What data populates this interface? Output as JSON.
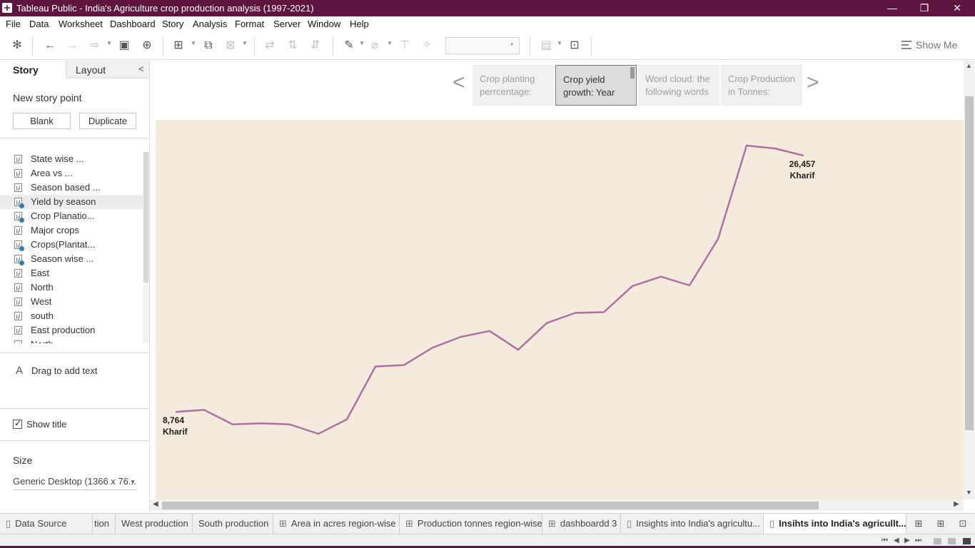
{
  "window": {
    "title": "Tableau Public - India's Agriculture crop production analysis (1997-2021)",
    "controls": {
      "minimize": "—",
      "restore": "❐",
      "close": "✕"
    }
  },
  "menu": [
    "File",
    "Data",
    "Worksheet",
    "Dashboard",
    "Story",
    "Analysis",
    "Format",
    "Server",
    "Window",
    "Help"
  ],
  "toolbar": {
    "show_me": "Show Me"
  },
  "left_panel": {
    "tabs": {
      "story": "Story",
      "layout": "Layout"
    },
    "new_story_point": "New story point",
    "blank_button": "Blank",
    "duplicate_button": "Duplicate",
    "sheets": [
      {
        "label": "State wise ...",
        "used": false,
        "highlighted": false
      },
      {
        "label": "Area vs ...",
        "used": false,
        "highlighted": false
      },
      {
        "label": "Season based ...",
        "used": false,
        "highlighted": false
      },
      {
        "label": "Yield by season",
        "used": true,
        "highlighted": true
      },
      {
        "label": "Crop Planatio...",
        "used": true,
        "highlighted": false
      },
      {
        "label": "Major crops",
        "used": false,
        "highlighted": false
      },
      {
        "label": "Crops(Plantat...",
        "used": true,
        "highlighted": false
      },
      {
        "label": "Season wise ...",
        "used": true,
        "highlighted": false
      },
      {
        "label": "East",
        "used": false,
        "highlighted": false
      },
      {
        "label": "North",
        "used": false,
        "highlighted": false
      },
      {
        "label": "West",
        "used": false,
        "highlighted": false
      },
      {
        "label": "south",
        "used": false,
        "highlighted": false
      },
      {
        "label": "East production",
        "used": false,
        "highlighted": false
      },
      {
        "label": "North...",
        "used": false,
        "highlighted": false
      }
    ],
    "drag_text": "Drag to add text",
    "show_title": "Show title",
    "show_title_checked": true,
    "size_label": "Size",
    "size_value": "Generic Desktop (1366 x 76..."
  },
  "story_points": [
    {
      "line1": "Crop planting",
      "line2": "perrcentage:",
      "active": false
    },
    {
      "line1": "Crop yield",
      "line2": "growth: Year",
      "active": true
    },
    {
      "line1": "Word cloud: the",
      "line2": "following words",
      "active": false
    },
    {
      "line1": "Crop Production",
      "line2": "in Tonnes:",
      "active": false
    }
  ],
  "chart_data": {
    "type": "line",
    "background": "#f4ebdc",
    "line_color": "#b06fa5",
    "series": [
      {
        "name": "Kharif",
        "values": [
          8764,
          8900,
          7900,
          7980,
          7900,
          7250,
          8250,
          11900,
          12000,
          13200,
          13950,
          14350,
          13050,
          14900,
          15600,
          15650,
          17450,
          18100,
          17500,
          20700,
          27150,
          26950,
          26457
        ]
      }
    ],
    "ylim": [
      7200,
      27150
    ],
    "labels": [
      {
        "value": "8,764",
        "series": "Kharif",
        "point": 0
      },
      {
        "value": "26,457",
        "series": "Kharif",
        "point": 22
      }
    ],
    "grid": false
  },
  "sheet_tabs": [
    {
      "label": "Data Source",
      "icon": "datasource-icon",
      "glyph": "▯",
      "active": false
    },
    {
      "label": "tion",
      "icon": "",
      "glyph": "",
      "active": false
    },
    {
      "label": "West production",
      "icon": "",
      "glyph": "",
      "active": false
    },
    {
      "label": "South production",
      "icon": "",
      "glyph": "",
      "active": false
    },
    {
      "label": "Area in acres region-wise",
      "icon": "dashboard-icon",
      "glyph": "⊞",
      "active": false
    },
    {
      "label": "Production tonnes region-wise",
      "icon": "dashboard-icon",
      "glyph": "⊞",
      "active": false
    },
    {
      "label": "dashboardd 3",
      "icon": "dashboard-icon",
      "glyph": "⊞",
      "active": false
    },
    {
      "label": "Insights into India's agricultu...",
      "icon": "story-icon",
      "glyph": "▯",
      "active": false
    },
    {
      "label": "Insihts into India's agricullt...",
      "icon": "story-icon",
      "glyph": "▯",
      "active": true
    }
  ]
}
